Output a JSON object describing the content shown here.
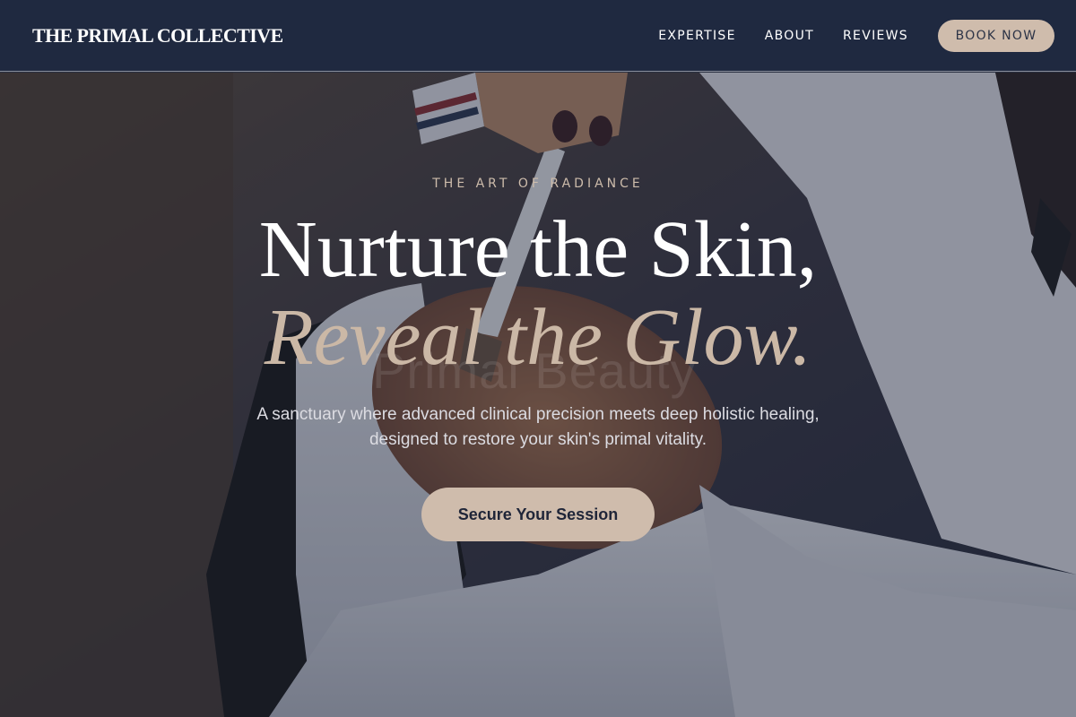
{
  "header": {
    "logo": "THE PRIMAL COLLECTIVE",
    "nav": [
      {
        "label": "EXPERTISE"
      },
      {
        "label": "ABOUT"
      },
      {
        "label": "REVIEWS"
      }
    ],
    "book_button": "BOOK NOW"
  },
  "hero": {
    "eyebrow": "THE ART OF RADIANCE",
    "headline_line1": "Nurture the Skin,",
    "headline_line2": "Reveal the Glow.",
    "watermark": "Primal Beauty",
    "description": "A sanctuary where advanced clinical precision meets deep holistic healing, designed to restore your skin's primal vitality.",
    "cta_label": "Secure Your Session"
  },
  "colors": {
    "header_bg": "#1f2940",
    "accent": "#cfbcac",
    "accent_text": "#cbb8a6",
    "overlay": "#1b2337"
  }
}
